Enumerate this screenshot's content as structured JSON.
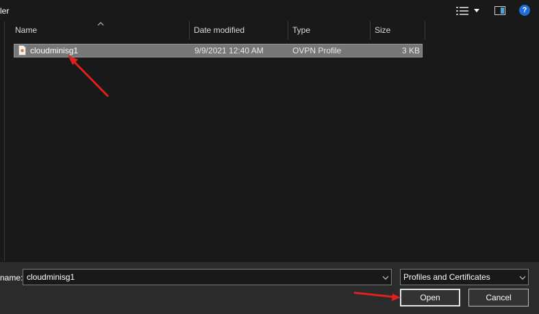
{
  "toolbar": {
    "title_fragment": "ler",
    "icons": [
      "view-options-icon",
      "dropdown-arrow-icon",
      "preview-pane-icon",
      "help-icon"
    ],
    "help_glyph": "?"
  },
  "columns": {
    "name": "Name",
    "date_modified": "Date modified",
    "type": "Type",
    "size": "Size"
  },
  "files": [
    {
      "name": "cloudminisg1",
      "date_modified": "9/9/2021 12:40 AM",
      "type": "OVPN Profile",
      "size": "3 KB",
      "selected": true
    }
  ],
  "footer": {
    "file_name_label": "name:",
    "file_name_value": "cloudminisg1",
    "file_type_value": "Profiles and Certificates",
    "open_label": "Open",
    "cancel_label": "Cancel"
  },
  "colors": {
    "background": "#191919",
    "selection": "#777777",
    "footer": "#2b2b2b",
    "annotation_arrow": "#e0201b",
    "help_icon": "#1f6fd8"
  }
}
